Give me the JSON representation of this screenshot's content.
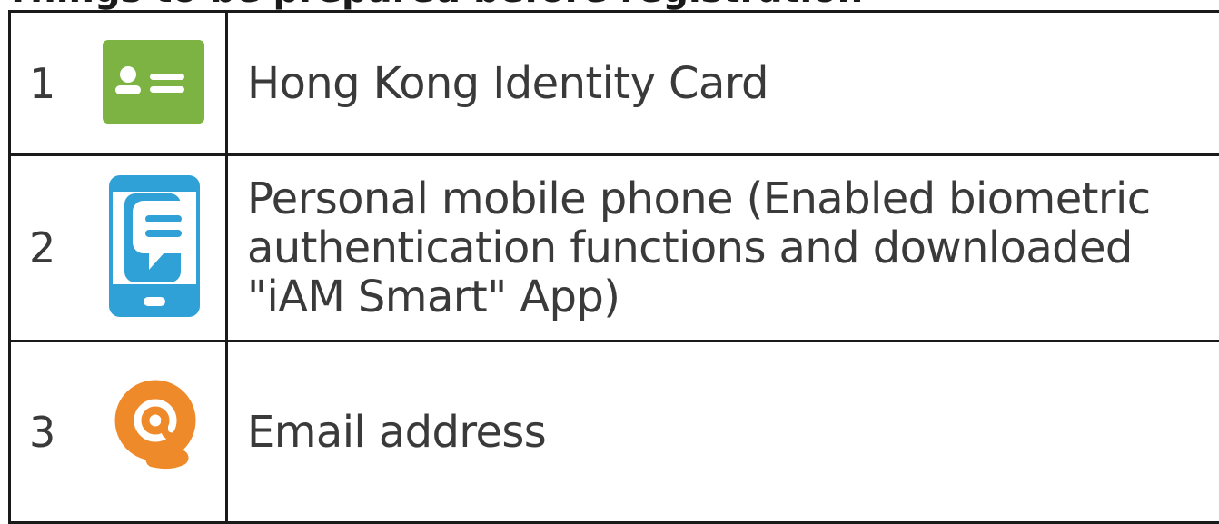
{
  "heading": "Things to be prepared before registration",
  "rows": [
    {
      "number": "1",
      "icon": "id-card-icon",
      "text": "Hong Kong Identity Card"
    },
    {
      "number": "2",
      "icon": "mobile-phone-icon",
      "text": "Personal mobile phone (Enabled biometric\nauthentication functions and downloaded\n\"iAM Smart\" App)"
    },
    {
      "number": "3",
      "icon": "at-sign-icon",
      "text": "Email address"
    }
  ],
  "colors": {
    "green": "#7cb342",
    "blue": "#2fa1d6",
    "orange": "#ef8a2b",
    "border": "#1a1a1a"
  }
}
